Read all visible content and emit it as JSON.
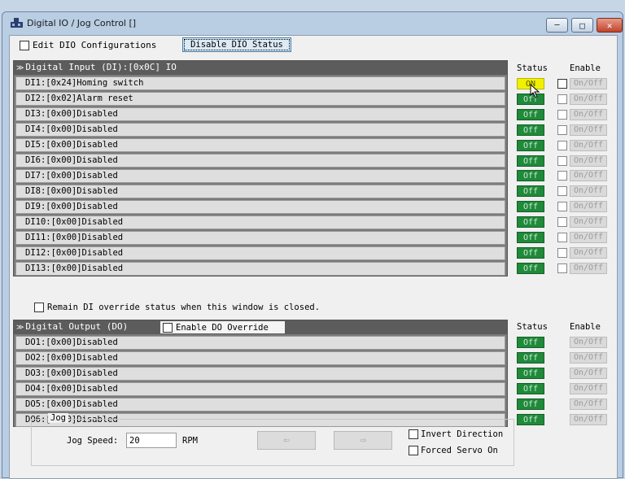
{
  "window": {
    "title": "Digital IO / Jog Control []",
    "minimize_glyph": "─",
    "maximize_glyph": "□",
    "close_glyph": "✕"
  },
  "toolbar": {
    "edit_label": "Edit DIO Configurations",
    "disable_status_label": "Disable DIO Status"
  },
  "di_panel": {
    "header": "Digital Input (DI):[0x0C] IO",
    "status_header": "Status",
    "enable_header": "Enable",
    "rows": [
      {
        "label": "DI1:[0x24]Homing switch",
        "status": "ON",
        "enable": "On/Off"
      },
      {
        "label": "DI2:[0x02]Alarm reset",
        "status": "Off",
        "enable": "On/Off"
      },
      {
        "label": "DI3:[0x00]Disabled",
        "status": "Off",
        "enable": "On/Off"
      },
      {
        "label": "DI4:[0x00]Disabled",
        "status": "Off",
        "enable": "On/Off"
      },
      {
        "label": "DI5:[0x00]Disabled",
        "status": "Off",
        "enable": "On/Off"
      },
      {
        "label": "DI6:[0x00]Disabled",
        "status": "Off",
        "enable": "On/Off"
      },
      {
        "label": "DI7:[0x00]Disabled",
        "status": "Off",
        "enable": "On/Off"
      },
      {
        "label": "DI8:[0x00]Disabled",
        "status": "Off",
        "enable": "On/Off"
      },
      {
        "label": "DI9:[0x00]Disabled",
        "status": "Off",
        "enable": "On/Off"
      },
      {
        "label": "DI10:[0x00]Disabled",
        "status": "Off",
        "enable": "On/Off"
      },
      {
        "label": "DI11:[0x00]Disabled",
        "status": "Off",
        "enable": "On/Off"
      },
      {
        "label": "DI12:[0x00]Disabled",
        "status": "Off",
        "enable": "On/Off"
      },
      {
        "label": "DI13:[0x00]Disabled",
        "status": "Off",
        "enable": "On/Off"
      }
    ]
  },
  "remain_label": "Remain DI override status when this window is closed.",
  "do_panel": {
    "header": "Digital Output (DO)",
    "override_label": "Enable DO Override",
    "status_header": "Status",
    "enable_header": "Enable",
    "rows": [
      {
        "label": "DO1:[0x00]Disabled",
        "status": "Off",
        "enable": "On/Off"
      },
      {
        "label": "DO2:[0x00]Disabled",
        "status": "Off",
        "enable": "On/Off"
      },
      {
        "label": "DO3:[0x00]Disabled",
        "status": "Off",
        "enable": "On/Off"
      },
      {
        "label": "DO4:[0x00]Disabled",
        "status": "Off",
        "enable": "On/Off"
      },
      {
        "label": "DO5:[0x00]Disabled",
        "status": "Off",
        "enable": "On/Off"
      },
      {
        "label": "DO6:[0x00]Disabled",
        "status": "Off",
        "enable": "On/Off"
      }
    ]
  },
  "jog": {
    "legend": "Jog",
    "speed_label": "Jog Speed:",
    "speed_value": "20",
    "unit": "RPM",
    "left_arrow": "⇦",
    "right_arrow": "⇨",
    "invert_label": "Invert Direction",
    "servo_label": "Forced Servo On"
  },
  "colors": {
    "status_on": "#f0f100",
    "status_off": "#1f8a3a",
    "panel_header": "#5c5c5c"
  }
}
